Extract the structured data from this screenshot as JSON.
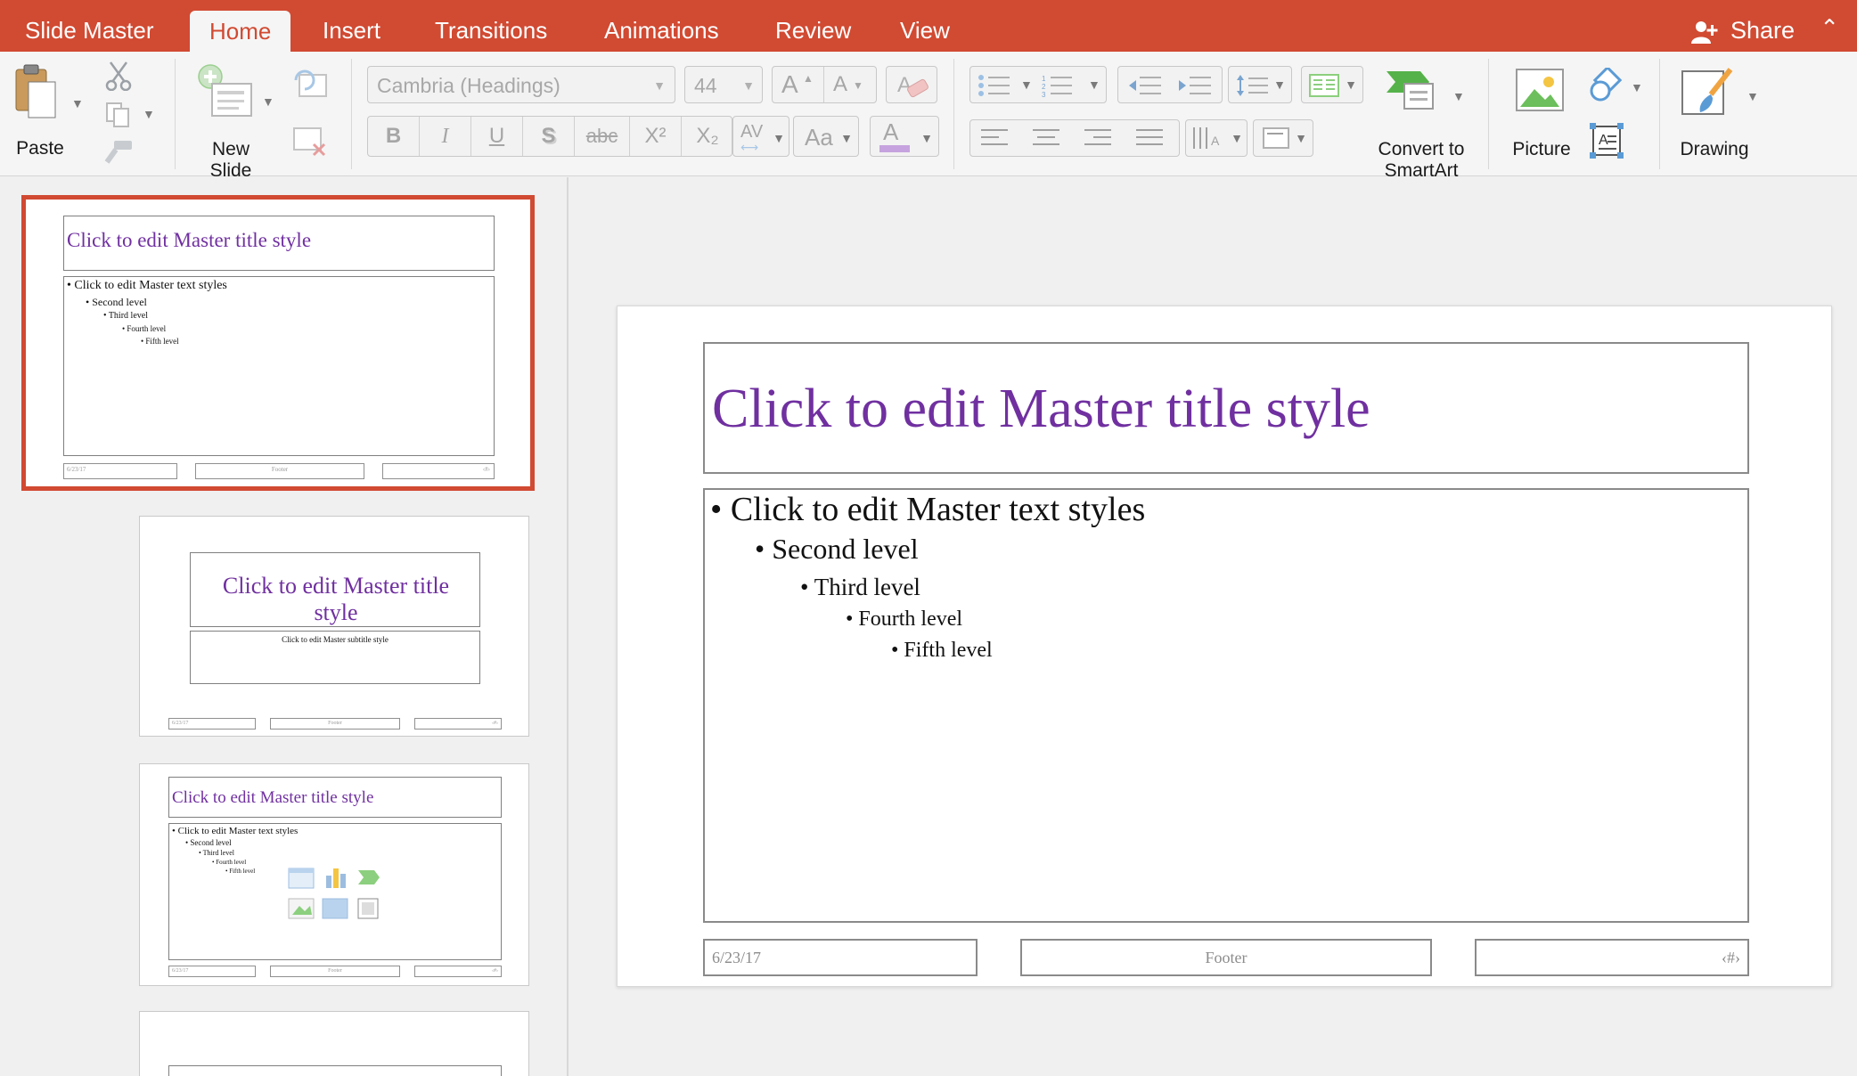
{
  "colors": {
    "accent": "#d14a32",
    "title_purple": "#7030a0",
    "ribbon_bg": "#f5f5f5"
  },
  "tabs": [
    {
      "label": "Slide Master",
      "active": false
    },
    {
      "label": "Home",
      "active": true
    },
    {
      "label": "Insert",
      "active": false
    },
    {
      "label": "Transitions",
      "active": false
    },
    {
      "label": "Animations",
      "active": false
    },
    {
      "label": "Review",
      "active": false
    },
    {
      "label": "View",
      "active": false
    }
  ],
  "share": {
    "label": "Share",
    "icon": "add-person-icon"
  },
  "ribbon": {
    "paste_label": "Paste",
    "new_slide_line1": "New",
    "new_slide_line2": "Slide",
    "font_name": "Cambria (Headings)",
    "font_size": "44",
    "bold": "B",
    "italic": "I",
    "underline": "U",
    "shadow": "S",
    "strike": "abc",
    "superscript": "X²",
    "subscript": "X₂",
    "char_spacing": "AV",
    "change_case": "Aa",
    "font_color": "A",
    "grow_font": "A",
    "shrink_font": "A",
    "convert_line1": "Convert to",
    "convert_line2": "SmartArt",
    "picture_label": "Picture",
    "drawing_label": "Drawing"
  },
  "thumbnails": [
    {
      "title": "Click to edit Master title style",
      "levels": [
        "Click to edit Master text styles",
        "Second level",
        "Third level",
        "Fourth level",
        "Fifth level"
      ],
      "date": "6/23/17",
      "footer": "Footer",
      "number": "‹#›"
    },
    {
      "title": "Click to edit Master title style",
      "subtitle": "Click to edit Master subtitle style",
      "date": "6/23/17",
      "footer": "Footer",
      "number": "‹#›"
    },
    {
      "title": "Click to edit Master title style",
      "levels": [
        "Click to edit Master text styles",
        "Second level",
        "Third level",
        "Fourth level",
        "Fifth level"
      ],
      "date": "6/23/17",
      "footer": "Footer",
      "number": "‹#›"
    }
  ],
  "slide": {
    "title": "Click to edit Master title style",
    "levels": [
      "Click to edit Master text styles",
      "Second level",
      "Third level",
      "Fourth level",
      "Fifth level"
    ],
    "date": "6/23/17",
    "footer": "Footer",
    "number": "‹#›"
  }
}
